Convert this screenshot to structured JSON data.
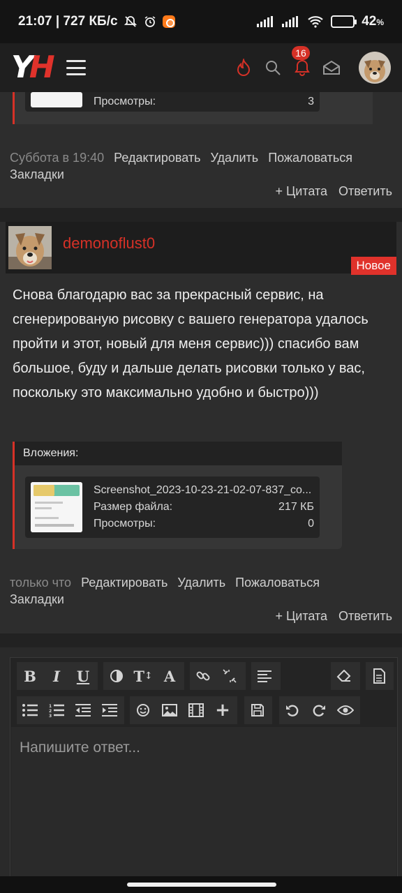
{
  "status_bar": {
    "time_speed": "21:07 | 727 КБ/с",
    "battery_pct": "42",
    "battery_pct_sign": "%",
    "battery_level": 0.42
  },
  "header": {
    "logo_left": "Y",
    "logo_right": "H",
    "notifications_count": "16",
    "icons": [
      "fire-icon",
      "search-icon",
      "bell-icon",
      "mail-icon"
    ]
  },
  "post1": {
    "views_label": "Просмотры:",
    "views_value": "3",
    "date": "Суббота в 19:40",
    "actions": [
      "Редактировать",
      "Удалить",
      "Пожаловаться"
    ],
    "bookmarks": "Закладки",
    "quote": "+ Цитата",
    "reply": "Ответить"
  },
  "post2": {
    "author": "demonoflust0",
    "badge": "Новое",
    "body": "Снова благодарю вас за прекрасный сервис, на сгенерированую рисовку с вашего генератора удалось пройти и этот, новый для меня сервис))) спасибо вам большое, буду и дальше делать рисовки только у вас, поскольку это максимально удобно и быстро)))",
    "attachments_label": "Вложения:",
    "attachment": {
      "filename": "Screenshot_2023-10-23-21-02-07-837_co...",
      "size_label": "Размер файла:",
      "size_value": "217 КБ",
      "views_label": "Просмотры:",
      "views_value": "0"
    },
    "date": "только что",
    "actions": [
      "Редактировать",
      "Удалить",
      "Пожаловаться"
    ],
    "bookmarks": "Закладки",
    "quote": "+ Цитата",
    "reply": "Ответить"
  },
  "editor": {
    "placeholder": "Напишите ответ...",
    "toolbar": {
      "bold": "B",
      "italic": "I",
      "underline": "U",
      "font_size": "T",
      "font_size_sub": "↕",
      "font_family": "A",
      "insert": "+"
    }
  },
  "colors": {
    "accent": "#d63127",
    "background": "#2b2b2b",
    "header_bg": "#1f1f1f"
  }
}
